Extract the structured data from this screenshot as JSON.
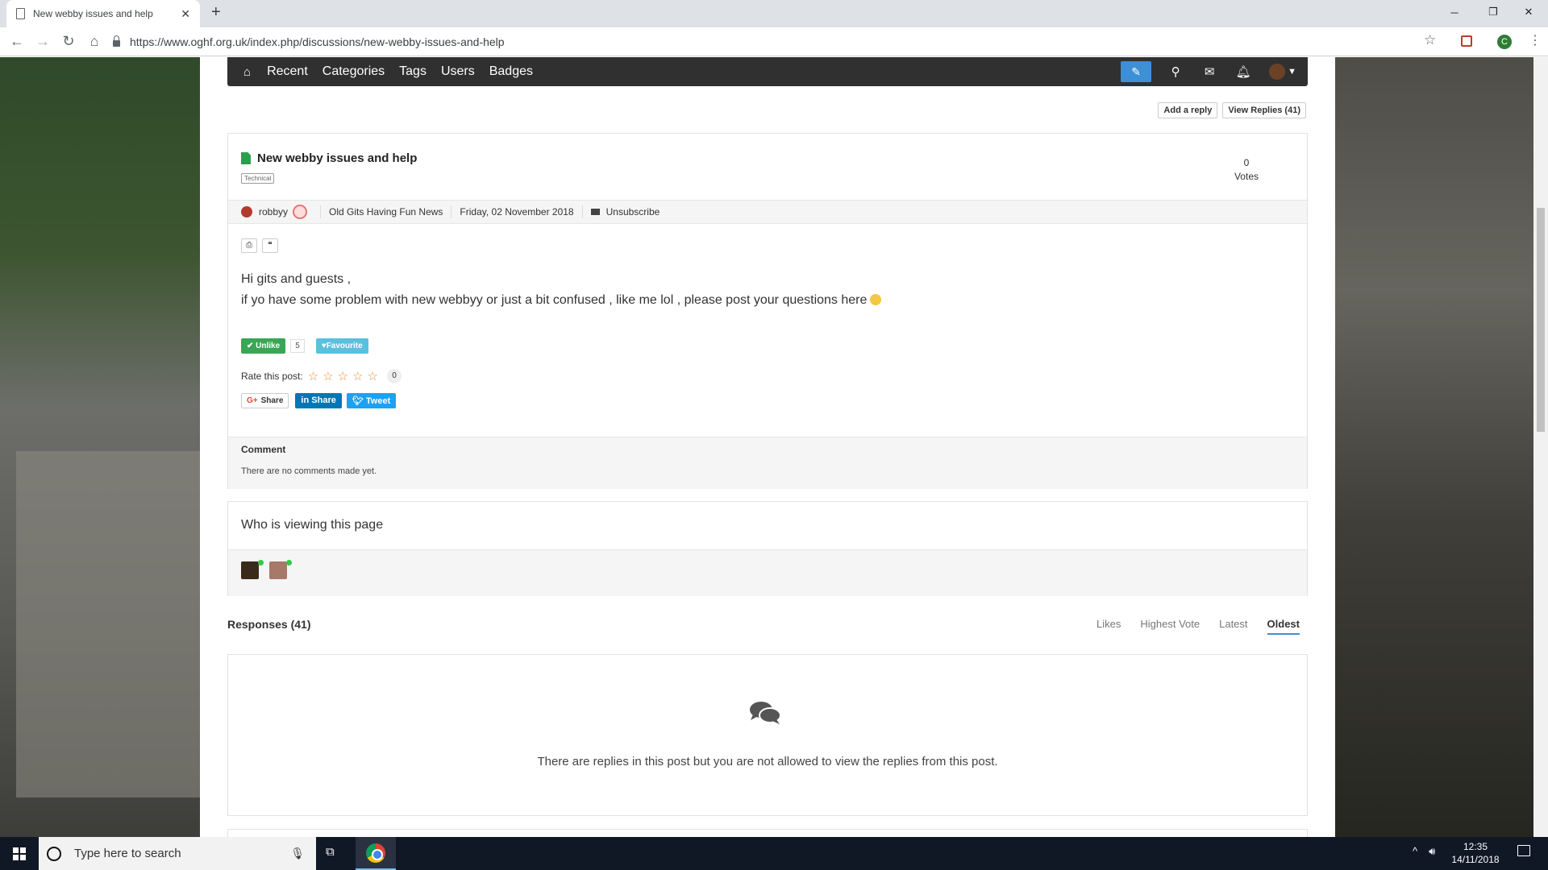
{
  "browser": {
    "tab_title": "New webby issues and help",
    "url": "https://www.oghf.org.uk/index.php/discussions/new-webby-issues-and-help",
    "profile_initial": "C"
  },
  "nav": {
    "links": [
      "Recent",
      "Categories",
      "Tags",
      "Users",
      "Badges"
    ],
    "accent_color": "#3d8fd6"
  },
  "actions": {
    "add_reply": "Add a reply",
    "view_replies": "View Replies (41)"
  },
  "post": {
    "title": "New webby issues and help",
    "tag": "Technical",
    "votes_count": "0",
    "votes_label": "Votes",
    "author": "robbyy",
    "category": "Old Gits Having Fun News",
    "date": "Friday, 02 November 2018",
    "unsubscribe": "Unsubscribe",
    "body_line1": "Hi gits and guests ,",
    "body_line2": "if yo have some problem with new webbyy or just a bit confused , like me lol , please post your questions here",
    "unlike_label": "Unlike",
    "like_count": "5",
    "favourite_label": "Favourite",
    "rate_label": "Rate this post:",
    "rating_count": "0",
    "gplus_share": "Share",
    "linkedin_share": "Share",
    "tweet": "Tweet"
  },
  "comments": {
    "title": "Comment",
    "empty_text": "There are no comments made yet."
  },
  "viewing": {
    "title": "Who is viewing this page"
  },
  "responses": {
    "title": "Responses (41)",
    "sorts": [
      "Likes",
      "Highest Vote",
      "Latest",
      "Oldest"
    ],
    "active_sort": "Oldest",
    "message": "There are replies in this post but you are not allowed to view the replies from this post."
  },
  "taskbar": {
    "search_placeholder": "Type here to search",
    "time": "12:35",
    "date": "14/11/2018"
  }
}
